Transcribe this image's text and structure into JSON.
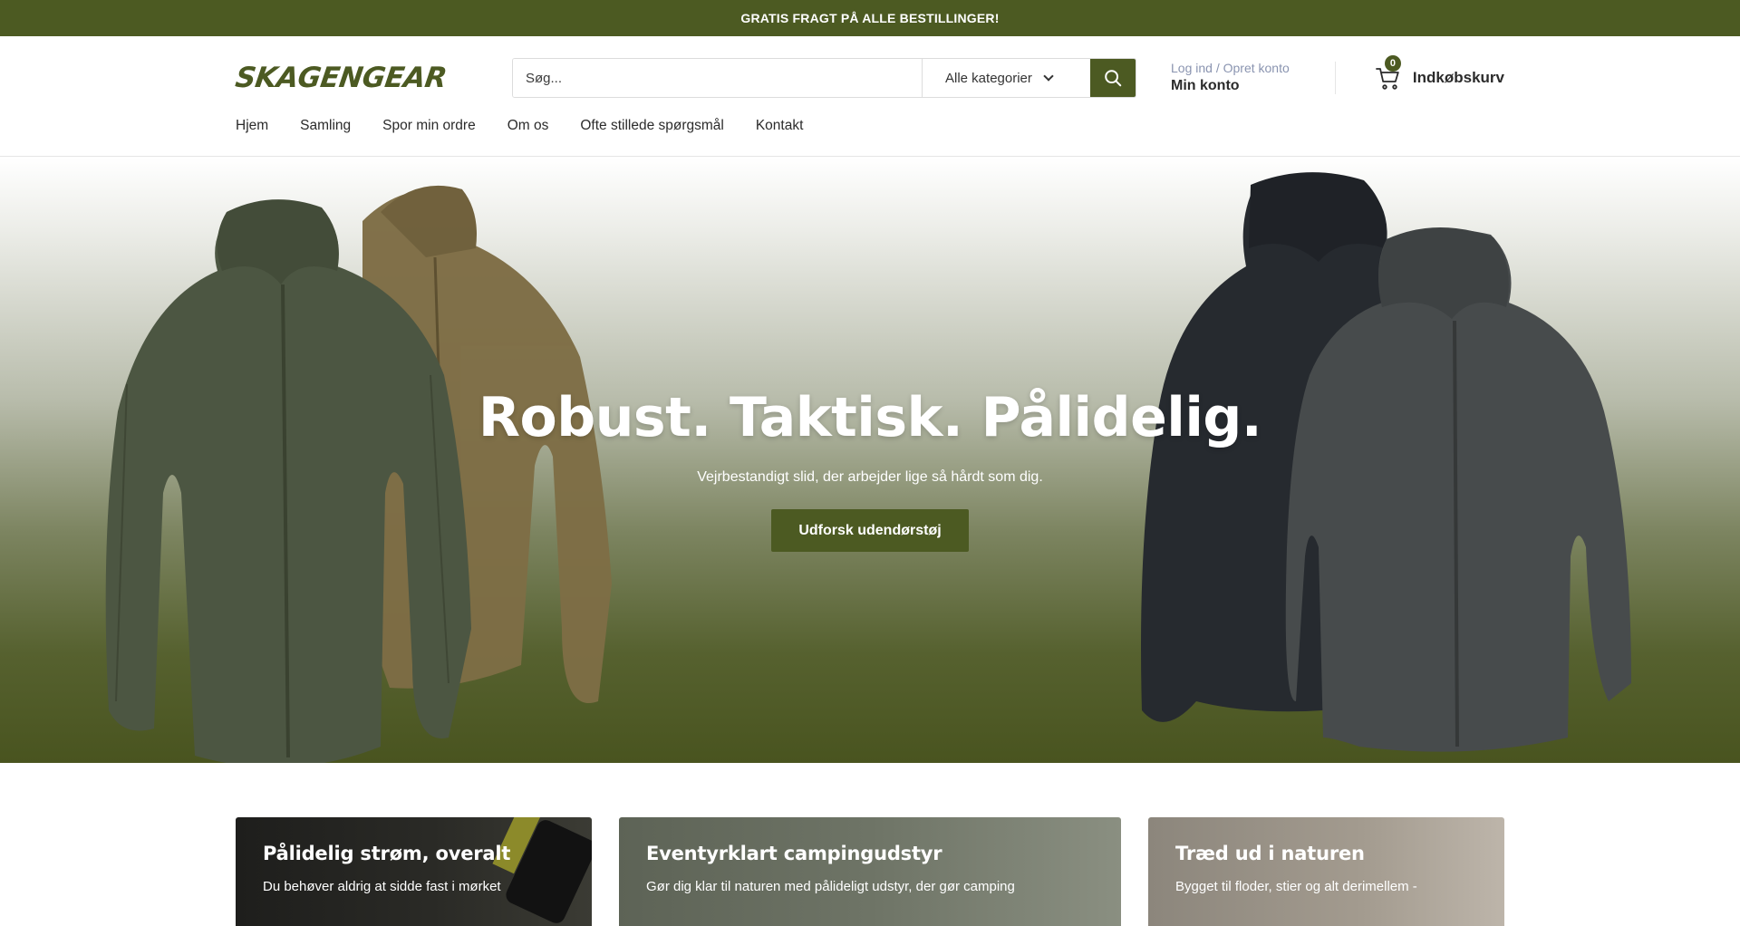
{
  "announcement": {
    "text": "GRATIS FRAGT PÅ ALLE BESTILLINGER!"
  },
  "header": {
    "logo_text": "SKAGENGEAR",
    "search": {
      "placeholder": "Søg...",
      "category_label": "Alle kategorier"
    },
    "account": {
      "top_text": "Log ind / Opret konto",
      "main_text": "Min konto"
    },
    "cart": {
      "count": "0",
      "label": "Indkøbskurv"
    }
  },
  "nav": {
    "items": [
      {
        "label": "Hjem"
      },
      {
        "label": "Samling"
      },
      {
        "label": "Spor min ordre"
      },
      {
        "label": "Om os"
      },
      {
        "label": "Ofte stillede spørgsmål"
      },
      {
        "label": "Kontakt"
      }
    ]
  },
  "hero": {
    "title": "Robust. Taktisk. Pålidelig.",
    "subtitle": "Vejrbestandigt slid, der arbejder lige så hårdt som dig.",
    "button": "Udforsk udendørstøj"
  },
  "features": [
    {
      "title": "Pålidelig strøm, overalt",
      "text": "Du behøver aldrig at sidde fast i mørket"
    },
    {
      "title": "Eventyrklart campingudstyr",
      "text": "Gør dig klar til naturen med pålideligt udstyr, der gør camping"
    },
    {
      "title": "Træd ud i naturen",
      "text": "Bygget til floder, stier og alt derimellem -"
    }
  ],
  "colors": {
    "brand": "#4c5a22",
    "text": "#2b2b2b",
    "muted": "#8a94b0"
  },
  "icons": {
    "search": "search-icon",
    "cart": "cart-icon",
    "chevron": "chevron-down-icon"
  }
}
